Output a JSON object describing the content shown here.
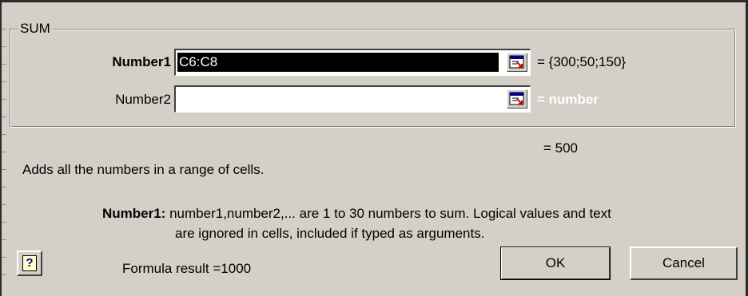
{
  "dialog": {
    "group_label": "SUM",
    "args": [
      {
        "label": "Number1",
        "value": "C6:C8",
        "evaluation": "= {300;50;150}"
      },
      {
        "label": "Number2",
        "value": "",
        "evaluation": "= number"
      }
    ],
    "function_result": "= 500",
    "function_description": "Adds all the numbers in a range of cells.",
    "arg_help_name": "Number1:",
    "arg_help_line1": "number1,number2,... are 1 to 30 numbers to sum. Logical values and text",
    "arg_help_line2": "are ignored in cells, included if typed as arguments.",
    "formula_result": "Formula result =1000",
    "ok_label": "OK",
    "cancel_label": "Cancel",
    "help_icon_text": "?"
  },
  "colors": {
    "dialog_face": "#d4d0c8",
    "selection": "#000000",
    "hint_text": "#ffffff"
  },
  "icons": {
    "collapse": "collapse-dialog-icon",
    "help": "help-icon"
  }
}
